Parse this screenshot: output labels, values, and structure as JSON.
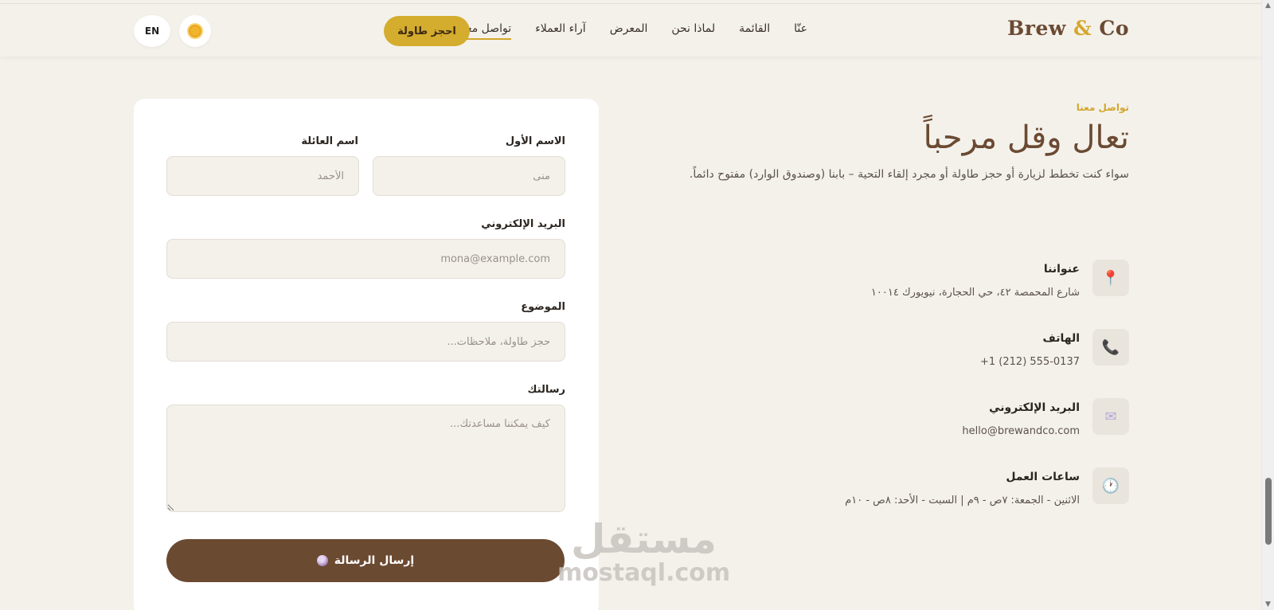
{
  "header": {
    "logo_brew": "Brew",
    "logo_amp": "&",
    "logo_co": "Co",
    "nav": [
      "عنّا",
      "القائمة",
      "لماذا نحن",
      "المعرض",
      "آراء العملاء",
      "تواصل معنا"
    ],
    "book_label": "احجز طاولة",
    "lang_label": "EN",
    "theme_icon": "sun-icon"
  },
  "info": {
    "eyebrow": "تواصل معنا",
    "title": "تعال وقل مرحباً",
    "description": "سواء كنت تخطط لزيارة أو حجز طاولة أو مجرد إلقاء التحية – بابنا (وصندوق الوارد) مفتوح دائماً.",
    "items": [
      {
        "icon": "pin-icon",
        "glyph": "📍",
        "title": "عنواننا",
        "value": "شارع المحمصة ٤٢، حي الحجارة، نيويورك ١٠٠١٤"
      },
      {
        "icon": "phone-icon",
        "glyph": "📞",
        "title": "الهاتف",
        "value": "+1 (212) 555-0137"
      },
      {
        "icon": "envelope-icon",
        "glyph": "✉",
        "title": "البريد الإلكتروني",
        "value": "hello@brewandco.com"
      },
      {
        "icon": "clock-icon",
        "glyph": "🕐",
        "title": "ساعات العمل",
        "value": "الاثنين - الجمعة: ٧ص - ٩م | السبت - الأحد: ٨ص - ١٠م"
      }
    ]
  },
  "form": {
    "first_name_label": "الاسم الأول",
    "first_name_placeholder": "منى",
    "last_name_label": "اسم العائلة",
    "last_name_placeholder": "الأحمد",
    "email_label": "البريد الإلكتروني",
    "email_placeholder": "mona@example.com",
    "subject_label": "الموضوع",
    "subject_placeholder": "حجز طاولة، ملاحظات...",
    "message_label": "رسالتك",
    "message_placeholder": "كيف يمكننا مساعدتك...",
    "submit_label": "إرسال الرسالة"
  },
  "watermark": {
    "arabic": "مستقل",
    "latin": "mostaql.com"
  },
  "colors": {
    "brand": "#6b4a32",
    "accent": "#d4a72c",
    "background": "#f4f1eb"
  }
}
